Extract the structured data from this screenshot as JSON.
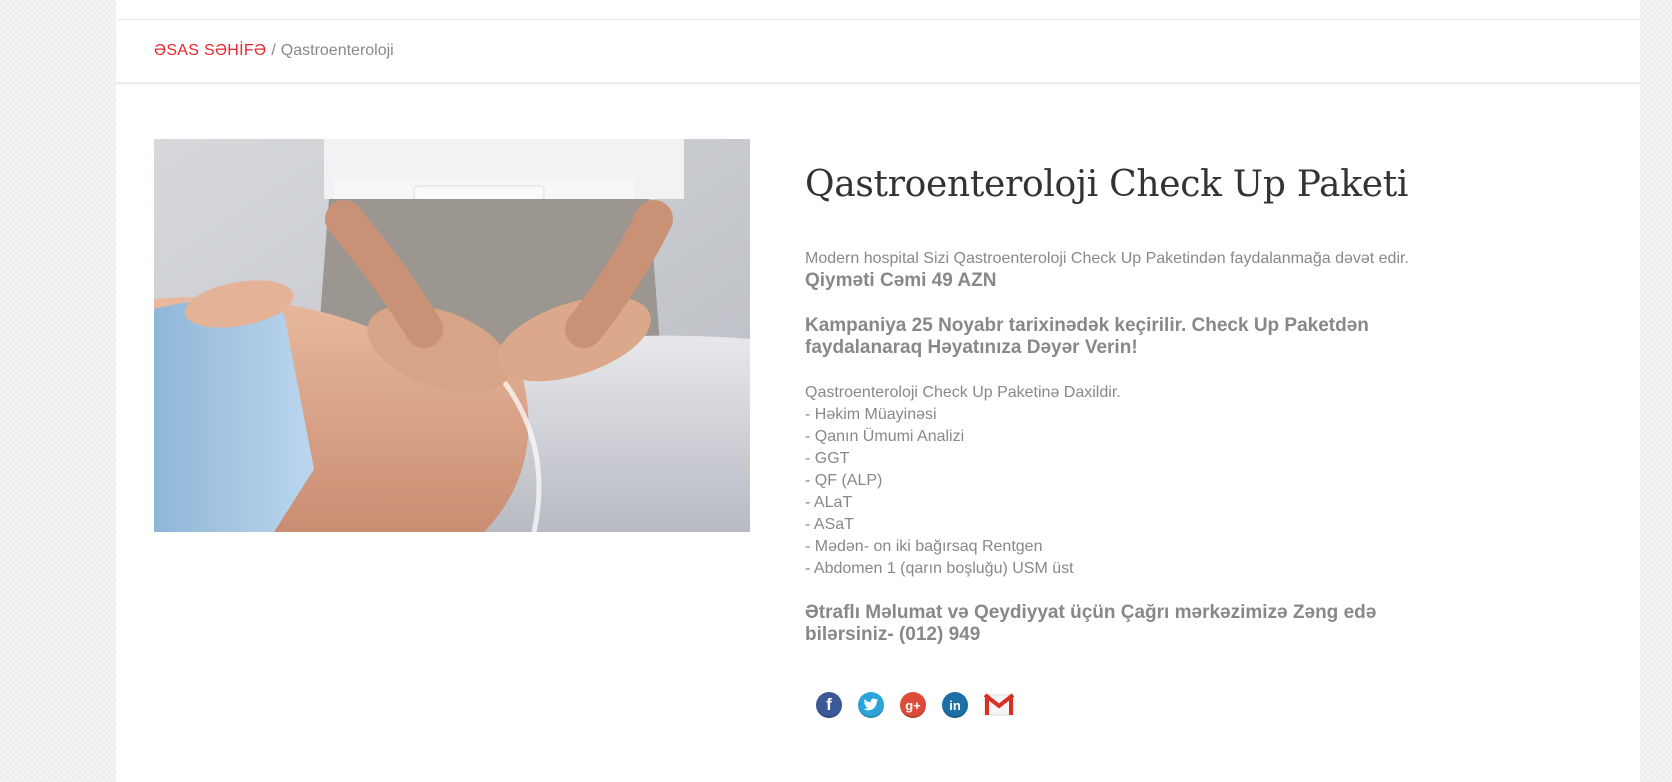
{
  "breadcrumb": {
    "home": "ƏSAS SƏHİFƏ",
    "separator": "/",
    "current": "Qastroenteroloji"
  },
  "main": {
    "title": "Qastroenteroloji Check Up Paketi",
    "intro": "Modern hospital Sizi Qastroenteroloji Check Up Paketindən faydalanmağa dəvət edir.",
    "price": "Qiyməti Cəmi 49 AZN",
    "campaign": "Kampaniya 25 Noyabr tarixinədək keçirilir. Check Up Paketdən faydalanaraq Həyatınıza Dəyər Verin!",
    "includes_heading": "Qastroenteroloji Check Up Paketinə Daxildir.",
    "includes": [
      "- Həkim Müayinəsi",
      "- Qanın Ümumi Analizi",
      "- GGT",
      "- QF (ALP)",
      "- ALaT",
      "- ASaT",
      "- Mədən- on iki bağırsaq Rentgen",
      "- Abdomen 1 (qarın boşluğu) USM üst"
    ],
    "contact": "Ətraflı Məlumat və Qeydiyyat üçün Çağrı mərkəzimizə Zəng edə bilərsiniz- (012) 949"
  },
  "share": {
    "icons": [
      "facebook-icon",
      "twitter-icon",
      "google-plus-icon",
      "linkedin-icon",
      "gmail-icon"
    ],
    "facebook_glyph": "f",
    "google_glyph": "g+",
    "linkedin_glyph": "in"
  },
  "colors": {
    "accent": "#e8262d",
    "text_muted": "#888888",
    "title": "#333333",
    "facebook": "#3b5998",
    "twitter": "#2ba4dc",
    "google_plus": "#dd4b39",
    "linkedin": "#1d6fa5"
  }
}
